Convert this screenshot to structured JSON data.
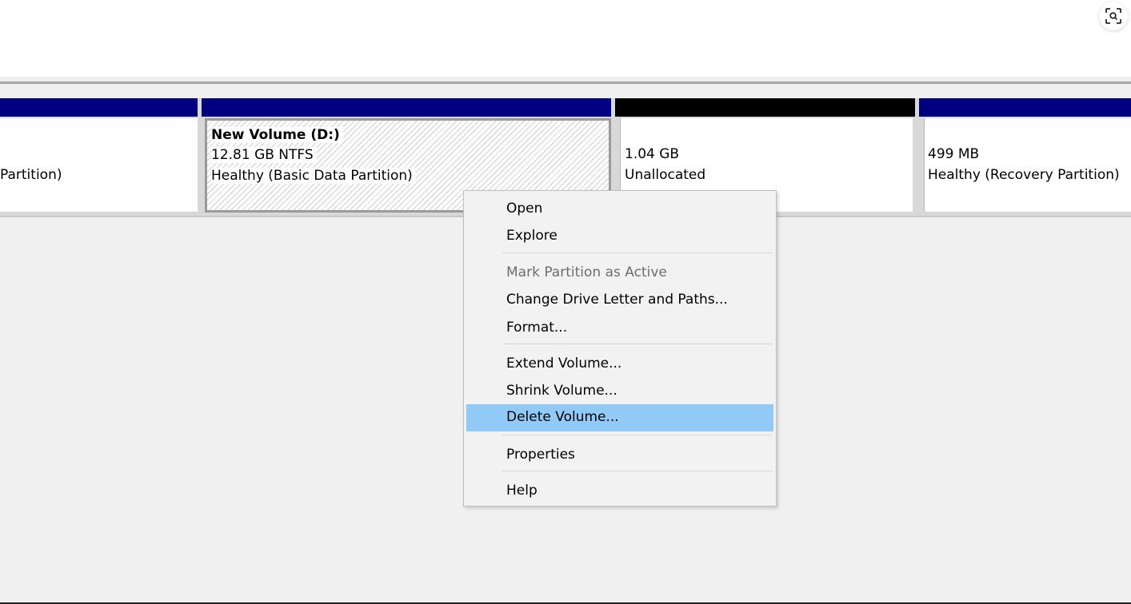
{
  "partitions": [
    {
      "name": "",
      "size": "",
      "status": "Partition)",
      "bar_color": "#000080"
    },
    {
      "name": "New Volume  (D:)",
      "size": "12.81 GB NTFS",
      "status": "Healthy (Basic Data Partition)",
      "bar_color": "#000080"
    },
    {
      "name": "",
      "size": "1.04 GB",
      "status": "Unallocated",
      "bar_color": "#000000"
    },
    {
      "name": "",
      "size": "499 MB",
      "status": "Healthy (Recovery Partition)",
      "bar_color": "#000080"
    }
  ],
  "context_menu": {
    "items": [
      {
        "label": "Open",
        "enabled": true
      },
      {
        "label": "Explore",
        "enabled": true
      },
      {
        "label": "Mark Partition as Active",
        "enabled": false
      },
      {
        "label": "Change Drive Letter and Paths...",
        "enabled": true
      },
      {
        "label": "Format...",
        "enabled": true
      },
      {
        "label": "Extend Volume...",
        "enabled": true
      },
      {
        "label": "Shrink Volume...",
        "enabled": true
      },
      {
        "label": "Delete Volume...",
        "enabled": true,
        "highlighted": true
      },
      {
        "label": "Properties",
        "enabled": true
      },
      {
        "label": "Help",
        "enabled": true
      }
    ],
    "highlight_color": "#91c9f7"
  },
  "icons": {
    "lens": "visual-search-icon"
  }
}
